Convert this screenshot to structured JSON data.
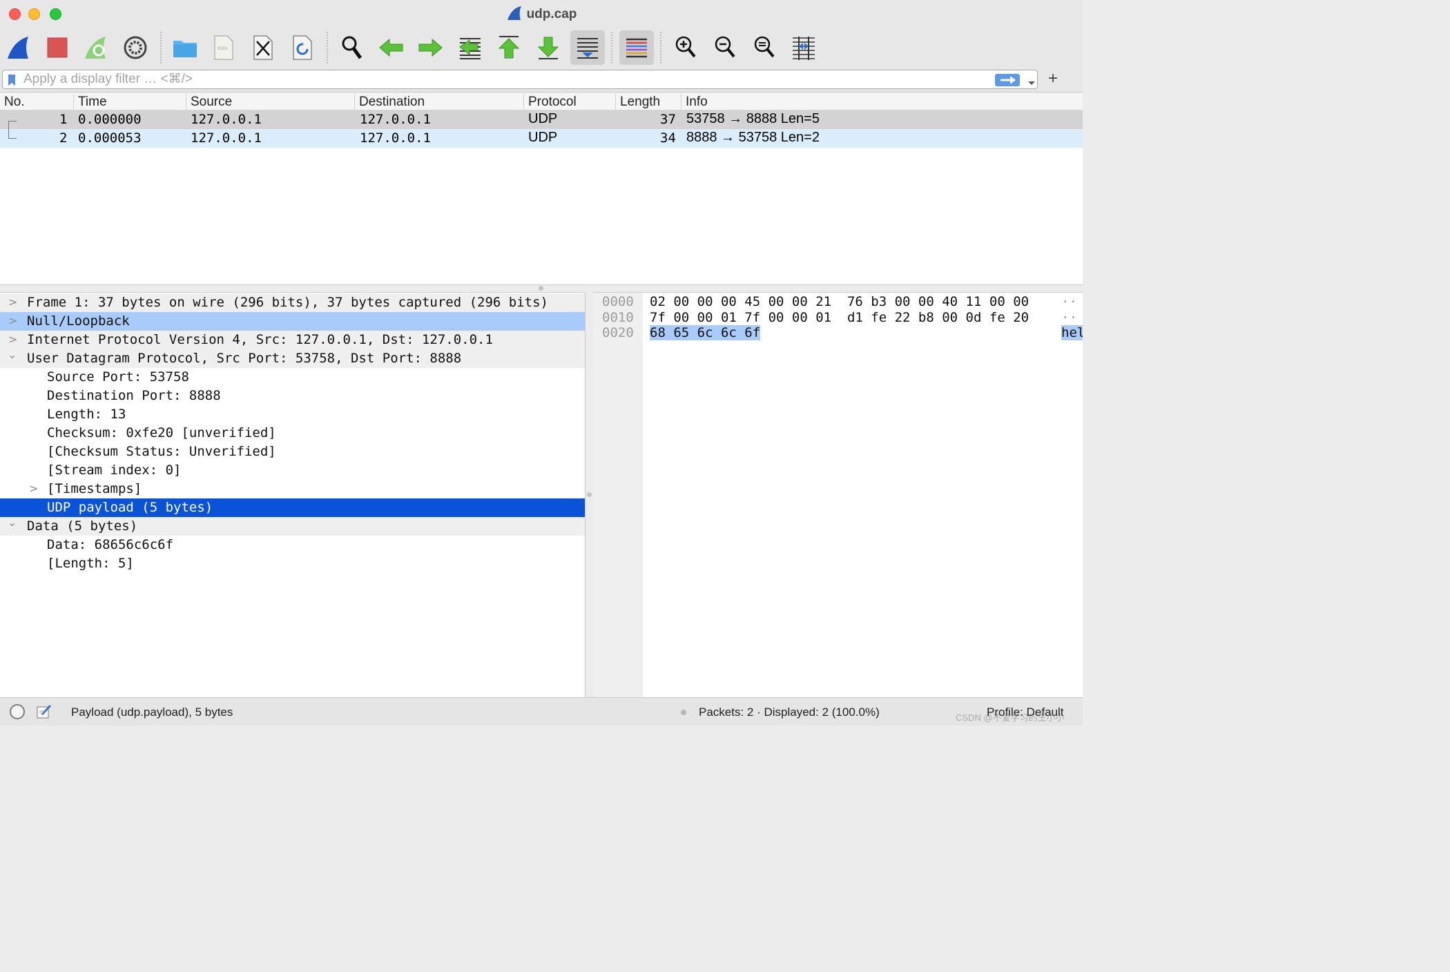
{
  "window": {
    "title": "udp.cap"
  },
  "toolbar": {
    "buttons": [
      "start-capture",
      "stop-capture",
      "restart-capture",
      "capture-options",
      "open-file",
      "save-file",
      "close-file",
      "reload-file",
      "find-packet",
      "go-back",
      "go-forward",
      "go-to-packet",
      "first-packet",
      "last-packet",
      "auto-scroll",
      "colorize",
      "zoom-in",
      "zoom-out",
      "normal-size",
      "resize-columns"
    ]
  },
  "filter": {
    "placeholder": "Apply a display filter … <⌘/>",
    "value": ""
  },
  "packet_list": {
    "columns": [
      "No.",
      "Time",
      "Source",
      "Destination",
      "Protocol",
      "Length",
      "Info"
    ],
    "rows": [
      {
        "no": "1",
        "time": "0.000000",
        "source": "127.0.0.1",
        "destination": "127.0.0.1",
        "protocol": "UDP",
        "length": "37",
        "info": "53758 → 8888 Len=5"
      },
      {
        "no": "2",
        "time": "0.000053",
        "source": "127.0.0.1",
        "destination": "127.0.0.1",
        "protocol": "UDP",
        "length": "34",
        "info": "8888 → 53758 Len=2"
      }
    ]
  },
  "details": {
    "rows": [
      {
        "text": "Frame 1: 37 bytes on wire (296 bits), 37 bytes captured (296 bits)",
        "chevron": ">"
      },
      {
        "text": "Null/Loopback",
        "chevron": ">"
      },
      {
        "text": "Internet Protocol Version 4, Src: 127.0.0.1, Dst: 127.0.0.1",
        "chevron": ">"
      },
      {
        "text": "User Datagram Protocol, Src Port: 53758, Dst Port: 8888",
        "chevron": "⌄"
      },
      {
        "text": "Source Port: 53758",
        "chevron": ""
      },
      {
        "text": "Destination Port: 8888",
        "chevron": ""
      },
      {
        "text": "Length: 13",
        "chevron": ""
      },
      {
        "text": "Checksum: 0xfe20 [unverified]",
        "chevron": ""
      },
      {
        "text": "[Checksum Status: Unverified]",
        "chevron": ""
      },
      {
        "text": "[Stream index: 0]",
        "chevron": ""
      },
      {
        "text": "[Timestamps]",
        "chevron": ">"
      },
      {
        "text": "UDP payload (5 bytes)",
        "chevron": ""
      },
      {
        "text": "Data (5 bytes)",
        "chevron": "⌄"
      },
      {
        "text": "Data: 68656c6c6f",
        "chevron": ""
      },
      {
        "text": "[Length: 5]",
        "chevron": ""
      }
    ]
  },
  "bytes": {
    "rows": [
      {
        "offset": "0000",
        "hex": "02 00 00 00 45 00 00 21  76 b3 00 00 40 11 00 00",
        "ascii": "··"
      },
      {
        "offset": "0010",
        "hex": "7f 00 00 01 7f 00 00 01  d1 fe 22 b8 00 0d fe 20",
        "ascii": "··"
      },
      {
        "offset": "0020",
        "hex": "68 65 6c 6c 6f",
        "ascii": "hel"
      }
    ]
  },
  "status": {
    "left": "Payload (udp.payload), 5 bytes",
    "middle": "Packets: 2 · Displayed: 2 (100.0%)",
    "right": "Profile: Default",
    "watermark": "CSDN @不爱学习的王小小"
  }
}
